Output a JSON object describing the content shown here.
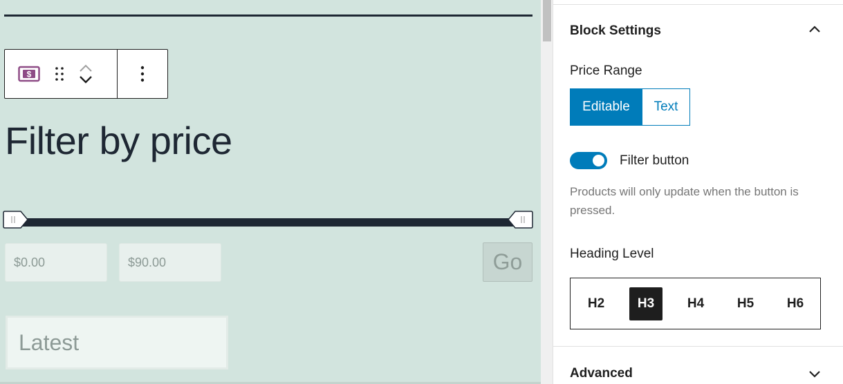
{
  "editor": {
    "heading": "Filter by price",
    "min_price": "$0.00",
    "max_price": "$90.00",
    "go_label": "Go",
    "sort_value": "Latest"
  },
  "toolbar": {
    "block_icon": "price-tag-icon",
    "drag_icon": "drag-handle-icon",
    "move_up_icon": "chevron-up-icon",
    "move_down_icon": "chevron-down-icon",
    "more_icon": "more-vertical-icon"
  },
  "sidebar": {
    "block_settings_title": "Block Settings",
    "price_range_label": "Price Range",
    "price_range_options": [
      "Editable",
      "Text"
    ],
    "price_range_selected": "Editable",
    "filter_button_label": "Filter button",
    "filter_button_enabled": true,
    "filter_button_help": "Products will only update when the button is pressed.",
    "heading_level_label": "Heading Level",
    "heading_levels": [
      "H2",
      "H3",
      "H4",
      "H5",
      "H6"
    ],
    "heading_level_selected": "H3",
    "advanced_title": "Advanced"
  },
  "colors": {
    "canvas_bg": "#d2e4de",
    "accent": "#007cba",
    "dark": "#1e2733",
    "block_icon": "#8e4b86"
  }
}
